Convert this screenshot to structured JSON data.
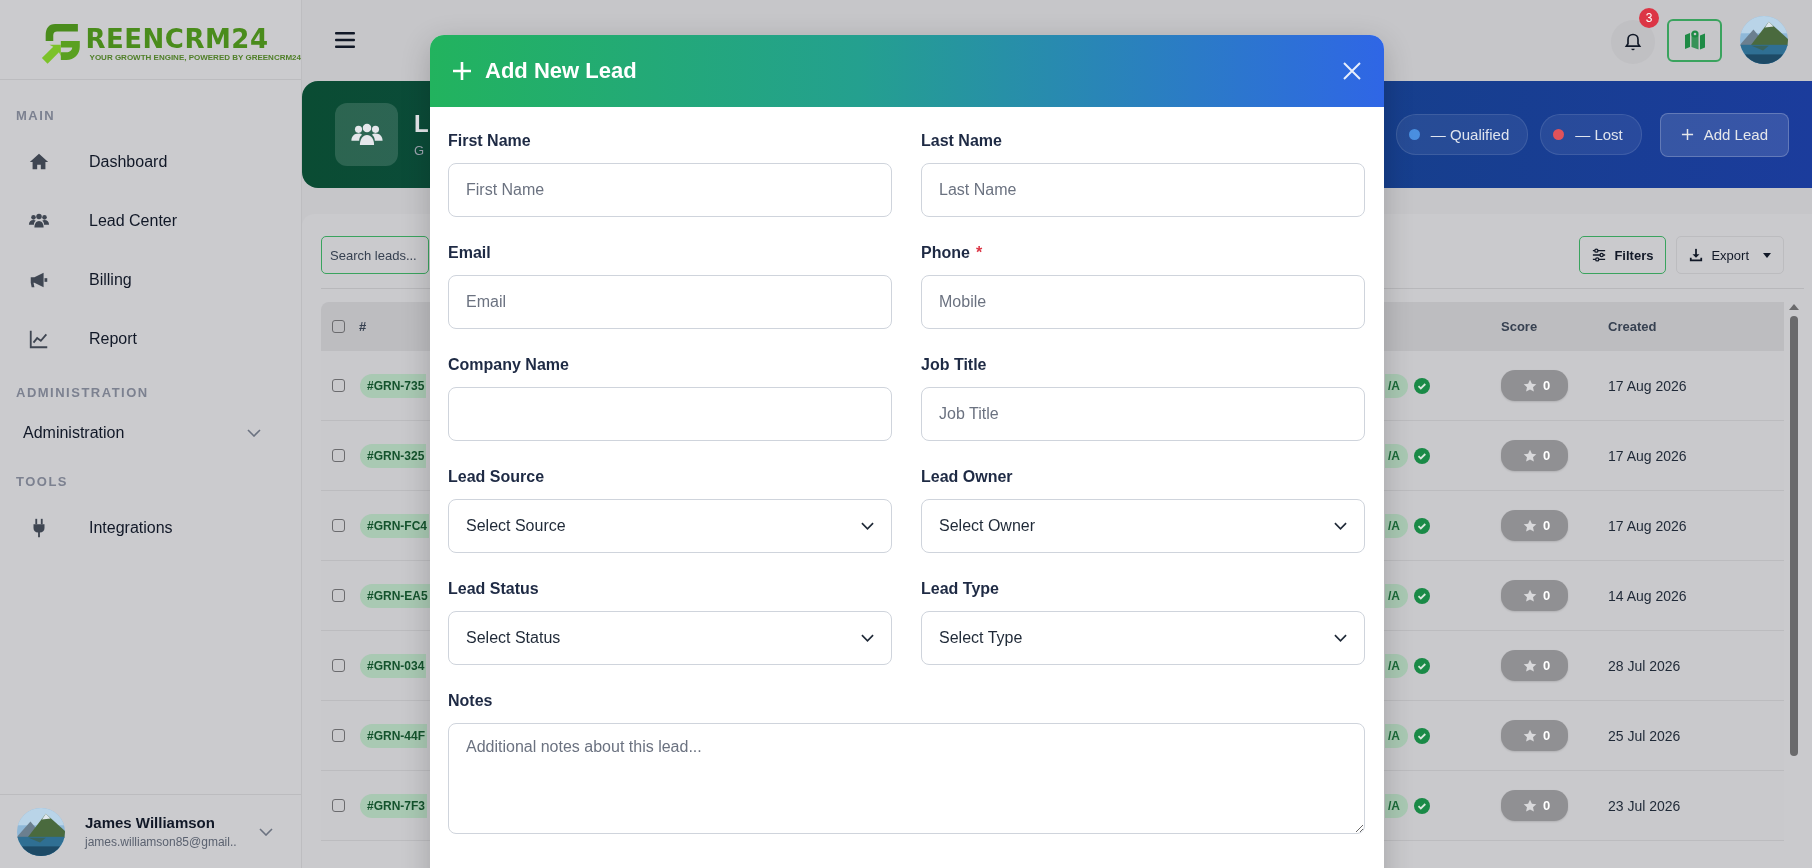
{
  "sidebar": {
    "logo": {
      "text": "REENCRM24",
      "tagline": "YOUR GROWTH ENGINE, POWERED BY GREENCRM24"
    },
    "sections": [
      {
        "heading": "MAIN",
        "items": [
          {
            "kind": "link",
            "label": "Dashboard",
            "selected": false
          },
          {
            "kind": "link",
            "label": "Lead Center",
            "selected": false
          },
          {
            "kind": "link",
            "label": "Billing",
            "selected": false
          },
          {
            "kind": "link",
            "label": "Report",
            "selected": false
          }
        ]
      },
      {
        "heading": "ADMINISTRATION",
        "items": [
          {
            "kind": "dropdown",
            "label": "Administration",
            "expanded": false
          }
        ]
      },
      {
        "heading": "TOOLS",
        "items": [
          {
            "kind": "link",
            "label": "Integrations",
            "selected": false
          }
        ]
      }
    ],
    "user": {
      "name": "James Williamson",
      "email": "james.williamson85@gmail.."
    }
  },
  "header": {
    "notification_count": "3"
  },
  "banner": {
    "title": "L",
    "subtitle": "G",
    "pills": [
      {
        "label": "— Qualified",
        "color": "#4a8fe0"
      },
      {
        "label": "— Lost",
        "color": "#e0525a"
      }
    ],
    "add_button": "Add Lead"
  },
  "toolbar": {
    "search": {
      "placeholder": "Search leads..."
    },
    "filters": "Filters",
    "export": "Export"
  },
  "table": {
    "all_checked": false,
    "columns": [
      "#",
      "Score",
      "Created"
    ],
    "rows": [
      {
        "checked": false,
        "id": "#GRN-735",
        "status": "/A",
        "verified": true,
        "score": "0",
        "created": "17 Aug 2026"
      },
      {
        "checked": false,
        "id": "#GRN-325",
        "status": "/A",
        "verified": true,
        "score": "0",
        "created": "17 Aug 2026"
      },
      {
        "checked": false,
        "id": "#GRN-FC4",
        "status": "/A",
        "verified": true,
        "score": "0",
        "created": "17 Aug 2026"
      },
      {
        "checked": false,
        "id": "#GRN-EA5",
        "status": "/A",
        "verified": true,
        "score": "0",
        "created": "14 Aug 2026"
      },
      {
        "checked": false,
        "id": "#GRN-034",
        "status": "/A",
        "verified": true,
        "score": "0",
        "created": "28 Jul 2026"
      },
      {
        "checked": false,
        "id": "#GRN-44F",
        "status": "/A",
        "verified": true,
        "score": "0",
        "created": "25 Jul 2026"
      },
      {
        "checked": false,
        "id": "#GRN-7F3",
        "status": "/A",
        "verified": true,
        "score": "0",
        "created": "23 Jul 2026"
      }
    ]
  },
  "modal": {
    "title": "Add New Lead",
    "fields": [
      {
        "kind": "text",
        "label": "First Name",
        "placeholder": "First Name"
      },
      {
        "kind": "text",
        "label": "Last Name",
        "placeholder": "Last Name"
      },
      {
        "kind": "text",
        "label": "Email",
        "placeholder": "Email"
      },
      {
        "kind": "text",
        "label": "Phone",
        "required_mark": "*",
        "placeholder": "Mobile"
      },
      {
        "kind": "text",
        "label": "Company Name"
      },
      {
        "kind": "text",
        "label": "Job Title",
        "placeholder": "Job Title"
      },
      {
        "kind": "select",
        "label": "Lead Source",
        "value": "Select Source"
      },
      {
        "kind": "select",
        "label": "Lead Owner",
        "value": "Select Owner"
      },
      {
        "kind": "select",
        "label": "Lead Status",
        "value": "Select Status"
      },
      {
        "kind": "select",
        "label": "Lead Type",
        "value": "Select Type"
      },
      {
        "kind": "textarea",
        "label": "Notes",
        "placeholder": "Additional notes about this lead..."
      }
    ]
  }
}
